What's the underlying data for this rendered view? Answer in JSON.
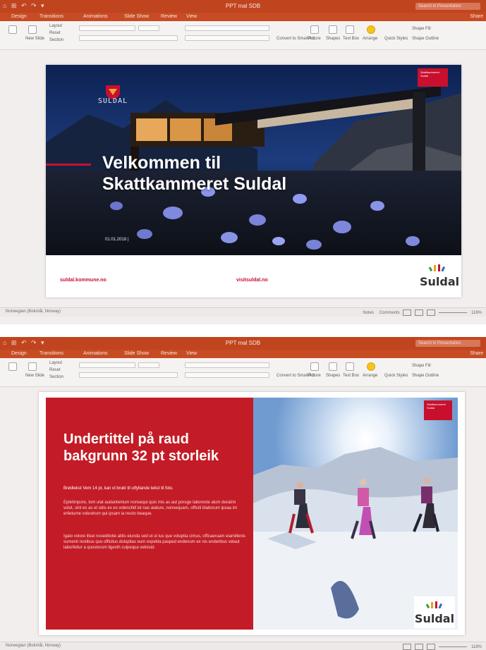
{
  "window1": {
    "quick_access": "⌂ ⊞ ↶ ↷ ▾",
    "doc_title": "PPT mal SDB",
    "search_placeholder": "Search in Presentation",
    "menu": [
      "Design",
      "Transitions",
      "Animations",
      "Slide Show",
      "Review",
      "View"
    ],
    "share": "Share",
    "ribbon": {
      "layout": "Layout",
      "reset": "Reset",
      "section": "Section",
      "new_slide": "New Slide",
      "convert": "Convert to SmartArt",
      "picture": "Picture",
      "shapes": "Shapes",
      "textbox": "Text Box",
      "arrange": "Arrange",
      "quick_styles": "Quick Styles",
      "shape_fill": "Shape Fill",
      "shape_outline": "Shape Outline"
    },
    "status_left": "Norwegian (Bokmål, Norway)",
    "status_notes": "Notes",
    "status_comments": "Comments",
    "zoom": "118%"
  },
  "slide1": {
    "brand_small": "SULDAL",
    "badge": "Skattkammeret Suldal",
    "title_line1": "Velkommen til",
    "title_line2": "Skattkammeret Suldal",
    "date": "01.01.2018 |",
    "link_left": "suldal.kommune.no",
    "link_center": "visitsuldal.no",
    "logo_text": "Suldal"
  },
  "window2": {
    "quick_access": "⌂ ⊞ ↶ ↷ ▾",
    "doc_title": "PPT mal SDB",
    "search_placeholder": "Search in Presentation",
    "menu": [
      "Design",
      "Transitions",
      "Animations",
      "Slide Show",
      "Review",
      "View"
    ],
    "share": "Share",
    "status_left": "Norwegian (Bokmål, Norway)",
    "zoom": "118%"
  },
  "slide2": {
    "badge": "Skattkammeret Suldal",
    "title": "Undertittel på raud bakgrunn 32 pt storleik",
    "p1": "Brødtekst Vem 14 pt, kan ol brukt til utfyllande tekst til foto.",
    "p2": "Epletimpore, tom ulat audantentum nonsequi quis mis as aut poruge laboreste alum deratmi volut, sint es as et odis ex es volenchill ist nas alature, nonsequam, officiti blaborum ipsaa int erlieturne volestrum qui ipsam ia necto beaque.",
    "p3": "Igaio volore illsei noseditotie alitis eiunda sed ut ut ius que voluptia cimus, officaeruam eiamillenis sumenti restibus quo officitus doluptias eum expelita pasped endenum ex nis enderibus velaut laborfeitur a quostorum ligenih culpequa velnisid.",
    "logo_text": "Suldal"
  }
}
